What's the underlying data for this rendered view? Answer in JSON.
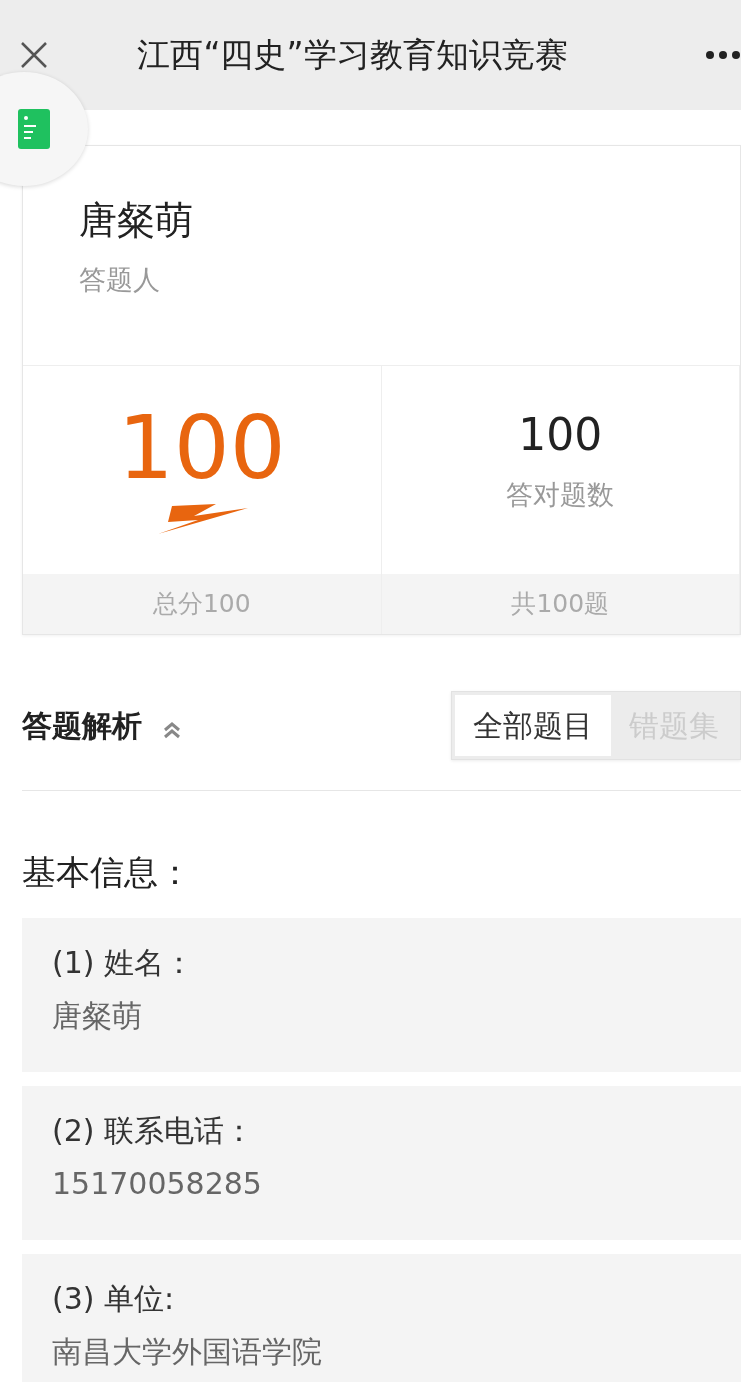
{
  "header": {
    "title": "江西“四史”学习教育知识竞赛"
  },
  "respondent": {
    "name": "唐粲萌",
    "label": "答题人"
  },
  "stats": [
    {
      "kind": "score",
      "value": "100",
      "footer": "总分100"
    },
    {
      "kind": "count",
      "value": "100",
      "caption": "答对题数",
      "footer": "共100题"
    }
  ],
  "analysis": {
    "title": "答题解析",
    "expanded": true,
    "tabs": [
      {
        "label": "全部题目",
        "selected": true
      },
      {
        "label": "错题集",
        "selected": false
      }
    ]
  },
  "basic_info": {
    "title": "基本信息：",
    "fields": [
      {
        "label": "(1) 姓名：",
        "value": "唐粲萌"
      },
      {
        "label": "(2) 联系电话：",
        "value": "15170058285"
      },
      {
        "label": "(3) 单位:",
        "value": "南昌大学外国语学院"
      }
    ]
  }
}
